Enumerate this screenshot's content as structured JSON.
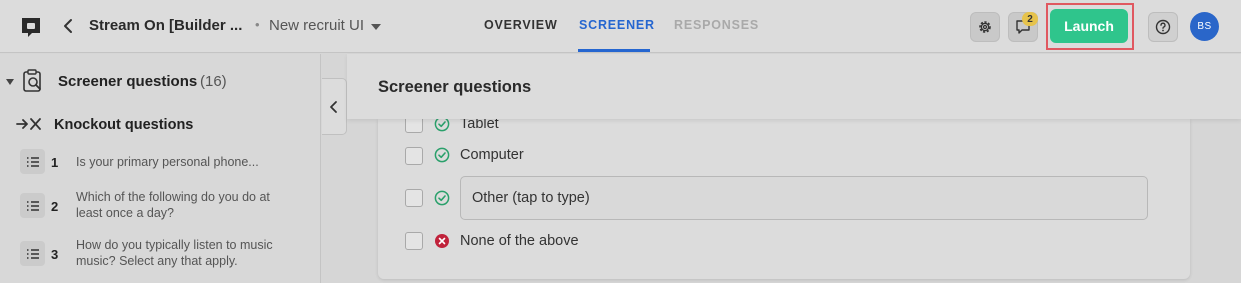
{
  "header": {
    "study_title": "Stream On [Builder ...",
    "separator": "•",
    "study_subtitle": "New recruit UI",
    "tabs": [
      {
        "label": "OVERVIEW"
      },
      {
        "label": "SCREENER"
      },
      {
        "label": "RESPONSES"
      }
    ],
    "comment_badge": "2",
    "launch_label": "Launch",
    "avatar_initials": "BS"
  },
  "sidebar": {
    "section_title": "Screener questions",
    "section_count": "(16)",
    "knockout_title": "Knockout questions",
    "questions": [
      {
        "number": "1",
        "text": "Is your primary personal phone..."
      },
      {
        "number": "2",
        "text": "Which of the following do you do at least once a day?"
      },
      {
        "number": "3",
        "text": "How do you typically listen to music music? Select any that apply."
      }
    ]
  },
  "main": {
    "title": "Screener questions",
    "options": [
      {
        "label": "Tablet",
        "status": "accept"
      },
      {
        "label": "Computer",
        "status": "accept"
      },
      {
        "label": "Other (tap to type)",
        "status": "accept"
      },
      {
        "label": "None of the above",
        "status": "reject"
      }
    ]
  },
  "colors": {
    "accent": "#2566d0",
    "launch": "#2fc58c",
    "accept": "#2aa06b",
    "reject": "#c0223b",
    "highlight": "#e05860"
  }
}
